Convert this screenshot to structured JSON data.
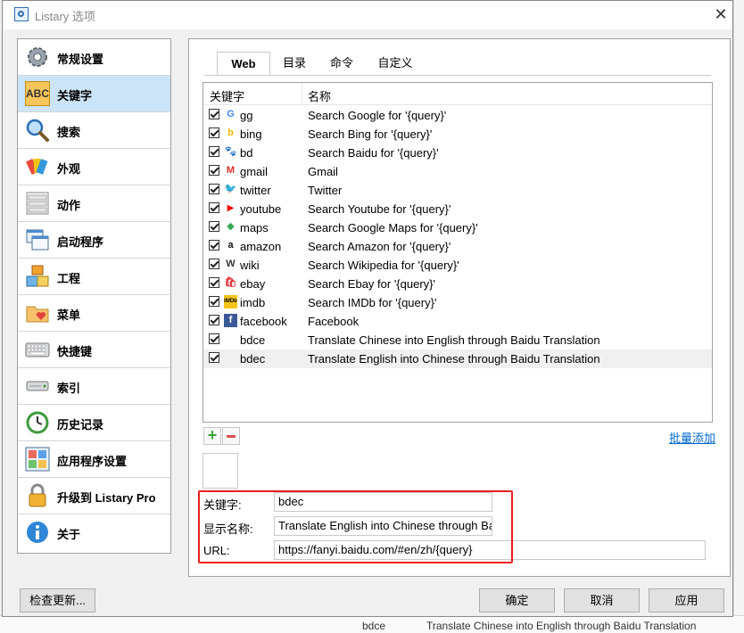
{
  "window": {
    "title": "Listary 选项",
    "close": "✕"
  },
  "sidebar": {
    "items": [
      {
        "label": "常规设置"
      },
      {
        "label": "关键字"
      },
      {
        "label": "搜索"
      },
      {
        "label": "外观"
      },
      {
        "label": "动作"
      },
      {
        "label": "启动程序"
      },
      {
        "label": "工程"
      },
      {
        "label": "菜单"
      },
      {
        "label": "快捷键"
      },
      {
        "label": "索引"
      },
      {
        "label": "历史记录"
      },
      {
        "label": "应用程序设置"
      },
      {
        "label": "升级到 Listary Pro"
      },
      {
        "label": "关于"
      }
    ],
    "selected": "关键字",
    "abc_icon_text": "ABC"
  },
  "tabs": [
    {
      "label": "Web"
    },
    {
      "label": "目录"
    },
    {
      "label": "命令"
    },
    {
      "label": "自定义"
    }
  ],
  "list": {
    "columns": {
      "keyword": "关键字",
      "name": "名称"
    },
    "rows": [
      {
        "keyword": "gg",
        "name": "Search Google for '{query}'",
        "icon": "google-icon",
        "glyph": "G",
        "color": "#4285f4"
      },
      {
        "keyword": "bing",
        "name": "Search Bing for '{query}'",
        "icon": "bing-icon",
        "glyph": "b",
        "color": "#f4b400"
      },
      {
        "keyword": "bd",
        "name": "Search Baidu for '{query}'",
        "icon": "baidu-icon",
        "glyph": "🐾",
        "color": "#2932e1"
      },
      {
        "keyword": "gmail",
        "name": "Gmail",
        "icon": "gmail-icon",
        "glyph": "M",
        "color": "#d93025"
      },
      {
        "keyword": "twitter",
        "name": "Twitter",
        "icon": "twitter-icon",
        "glyph": "🐦",
        "color": "#1da1f2"
      },
      {
        "keyword": "youtube",
        "name": "Search Youtube for '{query}'",
        "icon": "youtube-icon",
        "glyph": "▶",
        "color": "#ff0000"
      },
      {
        "keyword": "maps",
        "name": "Search Google Maps for '{query}'",
        "icon": "google-maps-icon",
        "glyph": "◆",
        "color": "#34a853"
      },
      {
        "keyword": "amazon",
        "name": "Search Amazon for '{query}'",
        "icon": "amazon-icon",
        "glyph": "a",
        "color": "#111111"
      },
      {
        "keyword": "wiki",
        "name": "Search Wikipedia for '{query}'",
        "icon": "wikipedia-icon",
        "glyph": "W",
        "color": "#333333"
      },
      {
        "keyword": "ebay",
        "name": "Search Ebay for '{query}'",
        "icon": "ebay-icon",
        "glyph": "🛍",
        "color": "#e53238"
      },
      {
        "keyword": "imdb",
        "name": "Search IMDb for '{query}'",
        "icon": "imdb-icon",
        "glyph": "IMDb",
        "color": "#f5c518"
      },
      {
        "keyword": "facebook",
        "name": "Facebook",
        "icon": "facebook-icon",
        "glyph": "f",
        "color": "#3b5998"
      },
      {
        "keyword": "bdce",
        "name": "Translate Chinese into English through Baidu Translation",
        "icon": "",
        "glyph": "",
        "color": ""
      },
      {
        "keyword": "bdec",
        "name": "Translate English into Chinese through Baidu Translation",
        "icon": "",
        "glyph": "",
        "color": ""
      }
    ],
    "selected_keyword": "bdec"
  },
  "list_controls": {
    "add": "+",
    "batch_add": "批量添加"
  },
  "form": {
    "keyword_label": "关键字:",
    "keyword_value": "bdec",
    "display_name_label": "显示名称:",
    "display_name_value": "Translate English into Chinese through Ba",
    "url_label": "URL:",
    "url_value": "https://fanyi.baidu.com/#en/zh/{query}"
  },
  "buttons": {
    "check_updates": "检查更新...",
    "ok": "确定",
    "cancel": "取消",
    "apply": "应用"
  },
  "background": {
    "bottom_keyword": "bdce",
    "bottom_name": "Translate Chinese into English through Baidu Translation"
  },
  "colors": {
    "selection": "#cce4f7",
    "link": "#0066cc",
    "highlight": "#e8201e"
  }
}
